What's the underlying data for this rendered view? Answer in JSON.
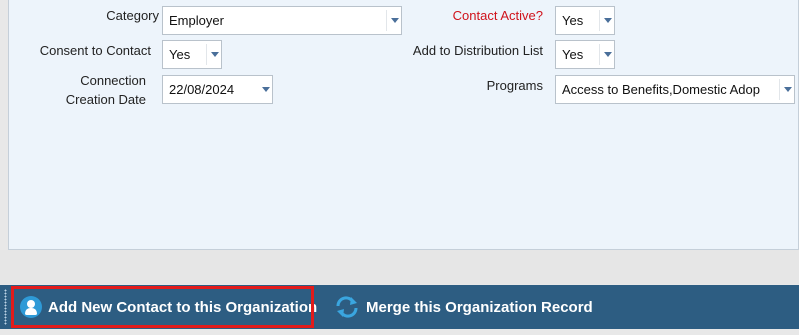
{
  "form": {
    "category_label": "Category",
    "category_value": "Employer",
    "consent_label": "Consent to Contact",
    "consent_value": "Yes",
    "connection_label_line1": "Connection",
    "connection_label_line2": "Creation Date",
    "connection_value": "22/08/2024",
    "contact_active_label": "Contact Active?",
    "contact_active_value": "Yes",
    "distribution_label": "Add to Distribution List",
    "distribution_value": "Yes",
    "programs_label": "Programs",
    "programs_value": "Access to Benefits,Domestic Adop"
  },
  "actions": {
    "add_contact_label": "Add New Contact to this Organization",
    "merge_label": "Merge this Organization Record"
  },
  "colors": {
    "action_bar": "#2d5d82",
    "required_label": "#d0121b",
    "highlight": "#e21b1b",
    "icon_accent": "#2e9ad7"
  },
  "icons": {
    "add_contact": "user-circle-icon",
    "merge": "merge-arrows-icon"
  }
}
